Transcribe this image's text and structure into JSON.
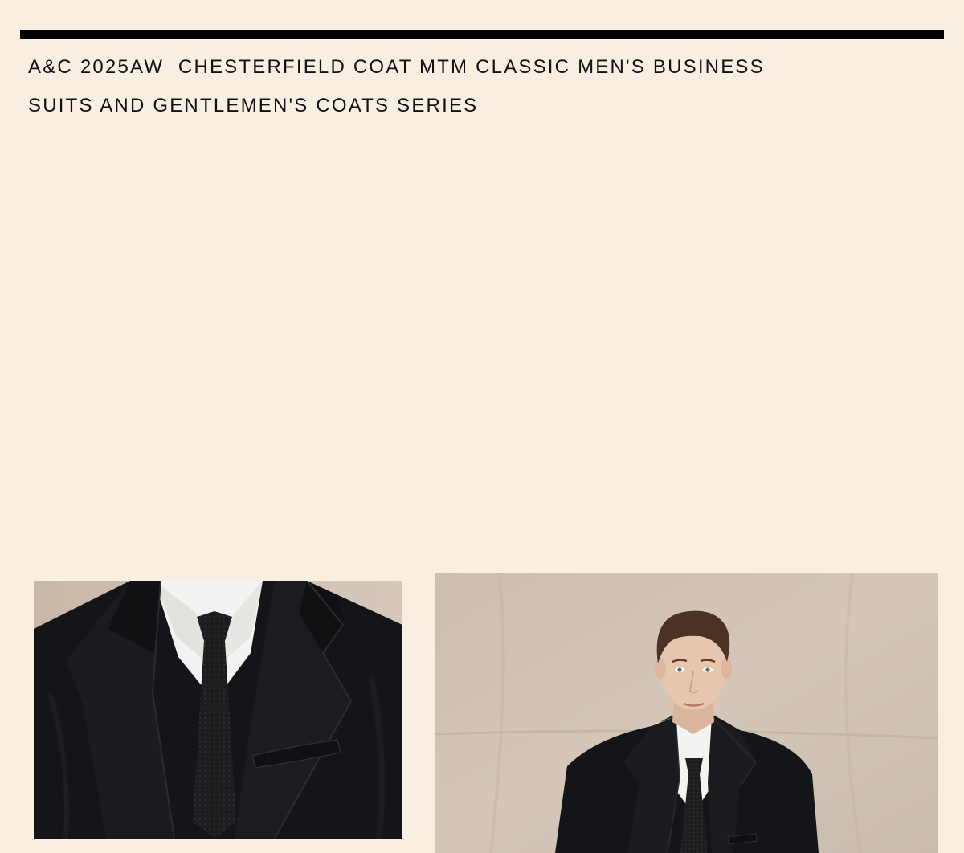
{
  "header": {
    "title": "A&C 2025AW  CHESTERFIELD COAT MTM CLASSIC MEN'S BUSINESS SUITS AND GENTLEMEN'S COATS SERIES"
  },
  "images": [
    {
      "name": "coat-lapel-closeup-photo",
      "subject": "close-up of black chesterfield coat lapel, white shirt and black knit tie"
    },
    {
      "name": "model-portrait-photo",
      "subject": "man in black chesterfield coat, white shirt and black tie against beige backdrop"
    }
  ],
  "colors": {
    "page_background": "#f8efe2",
    "rule": "#000000",
    "text": "#111111",
    "backdrop": "#cfc2b3",
    "coat": "#141518",
    "shirt": "#f4f4f2",
    "tie": "#1d1e20"
  }
}
